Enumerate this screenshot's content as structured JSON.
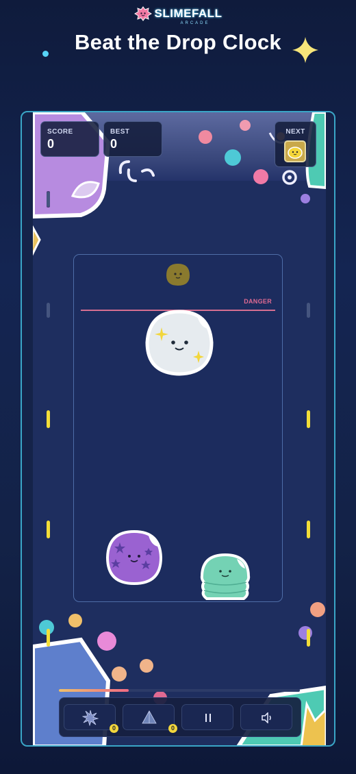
{
  "logo": {
    "title": "SLIMEFALL",
    "subtitle": "ARCADE"
  },
  "headline": "Beat the Drop Clock",
  "hud": {
    "score_label": "SCORE",
    "score_value": "0",
    "best_label": "BEST",
    "best_value": "0",
    "next_label": "NEXT",
    "next_slime": "yellow-slime"
  },
  "playfield": {
    "danger_label": "DANGER"
  },
  "slimes": [
    {
      "name": "held-slime",
      "color": "#8a7a2e",
      "type": "small-brown"
    },
    {
      "name": "white-slime",
      "color": "#e6ebef",
      "type": "sparkle-white"
    },
    {
      "name": "purple-slime",
      "color": "#9a62d1",
      "type": "star-purple"
    },
    {
      "name": "green-slime",
      "color": "#74d2b4",
      "type": "stack-green"
    }
  ],
  "drop_timer_fraction": 0.29,
  "controls": [
    {
      "name": "bomb-powerup",
      "icon": "bomb-icon",
      "count": "0"
    },
    {
      "name": "shake-powerup",
      "icon": "pyramid-icon",
      "count": "0"
    },
    {
      "name": "pause-button",
      "icon": "pause-icon"
    },
    {
      "name": "sound-button",
      "icon": "speaker-icon"
    }
  ],
  "colors": {
    "accent": "#3aa6c7",
    "danger": "#e06a92",
    "rail": "#f3de38"
  }
}
